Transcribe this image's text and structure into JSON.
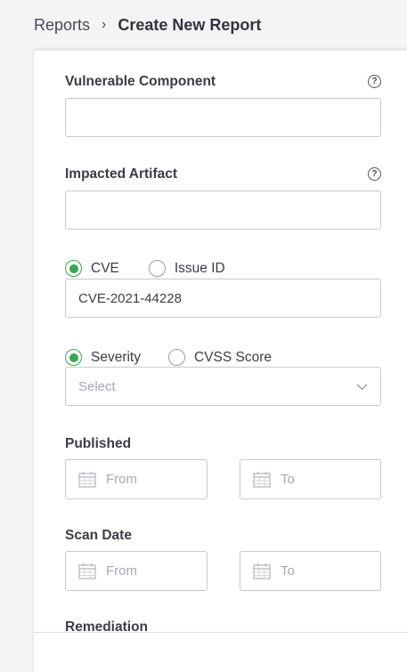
{
  "breadcrumb": {
    "parent": "Reports",
    "separator": "›",
    "current": "Create New Report"
  },
  "form": {
    "vulnerable_component": {
      "label": "Vulnerable Component",
      "value": "",
      "help_icon": "question-circle-icon"
    },
    "impacted_artifact": {
      "label": "Impacted Artifact",
      "value": "",
      "help_icon": "question-circle-icon"
    },
    "id_type": {
      "options": [
        {
          "label": "CVE",
          "checked": true
        },
        {
          "label": "Issue ID",
          "checked": false
        }
      ],
      "value": "CVE-2021-44228"
    },
    "score_type": {
      "options": [
        {
          "label": "Severity",
          "checked": true
        },
        {
          "label": "CVSS Score",
          "checked": false
        }
      ],
      "select_placeholder": "Select"
    },
    "published": {
      "label": "Published",
      "from_placeholder": "From",
      "to_placeholder": "To"
    },
    "scan_date": {
      "label": "Scan Date",
      "from_placeholder": "From",
      "to_placeholder": "To"
    },
    "remediation": {
      "label": "Remediation"
    }
  },
  "colors": {
    "accent_green": "#3aa653",
    "border": "#c8c8d0",
    "placeholder": "#a8a8b2"
  }
}
